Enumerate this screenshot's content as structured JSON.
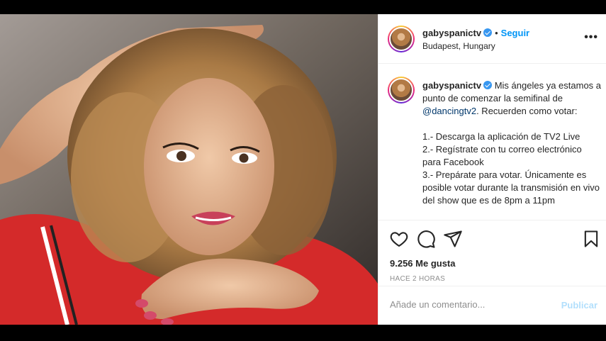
{
  "post": {
    "username": "gabyspanictv",
    "follow_label": "Seguir",
    "separator": "•",
    "location": "Budapest, Hungary",
    "more_label": "•••",
    "caption": {
      "username": "gabyspanictv",
      "text_before_mention": "Mis ángeles ya estamos a punto de comenzar la semifinal de ",
      "mention": "@dancingtv2",
      "text_after_mention": ". Recuerden como votar:\n\n1.- Descarga la aplicación de TV2 Live\n2.- Regístrate con tu correo electrónico para Facebook\n3.- Prepárate para votar. Únicamente es posible votar durante la transmisión en vivo del show que es de 8pm a 11pm"
    },
    "icons": [
      "heart-icon",
      "comment-icon",
      "share-icon",
      "bookmark-icon"
    ],
    "likes": "9.256 Me gusta",
    "time": "HACE 2 HORAS",
    "comment_placeholder": "Añade un comentario...",
    "publish_label": "Publicar",
    "colors": {
      "link": "#0095f6",
      "verified": "#3897f0",
      "publish_disabled": "#b2dffc",
      "shirt": "#d42a2a"
    }
  }
}
